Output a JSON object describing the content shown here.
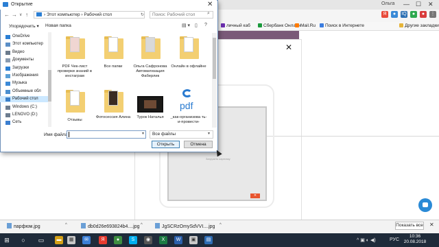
{
  "browser": {
    "user": "Ольга",
    "bookmarks": [
      {
        "label": "личный каб",
        "color": "#6c2fb0"
      },
      {
        "label": "Сбербанк Онлайн",
        "color": "#1a9a3c"
      },
      {
        "label": "Mail.Ru",
        "color": "#ff7a00"
      },
      {
        "label": "Поиск в Интернете",
        "color": "#3b7de0"
      },
      {
        "label": "Другие закладки",
        "color": "#e6b53a"
      }
    ]
  },
  "page": {
    "close_glyph": "✕",
    "screen_label": "Загрузить картинку",
    "screen_button": "✕"
  },
  "dialog": {
    "title": "Открытие",
    "path": [
      "Этот компьютер",
      "Рабочий стол"
    ],
    "search_placeholder": "Поиск: Рабочий стол",
    "toolbar": {
      "organize": "Упорядочить ▾",
      "new_folder": "Новая папка"
    },
    "nav_items": [
      {
        "label": "OneDrive",
        "icon": "onedrive-icon",
        "color": "#2b7fd4"
      },
      {
        "label": "Этот компьютер",
        "icon": "computer-icon",
        "color": "#5b8fc7"
      },
      {
        "label": "Видео",
        "icon": "video-icon",
        "color": "#6b7b8c"
      },
      {
        "label": "Документы",
        "icon": "documents-icon",
        "color": "#8a9bb0"
      },
      {
        "label": "Загрузки",
        "icon": "downloads-icon",
        "color": "#2b7fd4"
      },
      {
        "label": "Изображения",
        "icon": "pictures-icon",
        "color": "#5aa0d8"
      },
      {
        "label": "Музыка",
        "icon": "music-icon",
        "color": "#3b8ad8"
      },
      {
        "label": "Объемные обл",
        "icon": "3d-objects-icon",
        "color": "#4a8fd0"
      },
      {
        "label": "Рабочий стол",
        "icon": "desktop-icon",
        "color": "#3a7fc9"
      },
      {
        "label": "Windows (C:)",
        "icon": "drive-c-icon",
        "color": "#6d7d8f"
      },
      {
        "label": "LENOVO (D:)",
        "icon": "drive-d-icon",
        "color": "#6d7d8f"
      },
      {
        "label": "Сеть",
        "icon": "network-icon",
        "color": "#3b7fd0"
      }
    ],
    "files": [
      {
        "label": "PDF Чек-лист проверки знаний в инстаграм",
        "type": "folder"
      },
      {
        "label": "Все папки",
        "type": "folder"
      },
      {
        "label": "Ольга Сафронова Автоматизация Фаберлик",
        "type": "folder"
      },
      {
        "label": "Онлайн в офлайне",
        "type": "folder"
      },
      {
        "label": "Отзывы",
        "type": "folder"
      },
      {
        "label": "Фотосессия Алина",
        "type": "folder"
      },
      {
        "label": "Турок Наталья",
        "type": "video"
      },
      {
        "label": "_как-организова ть-и-провести-",
        "type": "pdf"
      }
    ],
    "filename_label": "Имя файла:",
    "filename_value": "",
    "filter": "Все файлы",
    "open_button": "Открыть",
    "cancel_button": "Отмена"
  },
  "downloads": {
    "items": [
      "парфюм.jpg",
      "db0d26e693824b4....jpg",
      "JgSCRzOmySdVVI....jpg"
    ],
    "show_all": "Показать все",
    "close_glyph": "✕"
  },
  "taskbar": {
    "lang": "РУС",
    "time": "10:36",
    "date": "20.08.2018"
  }
}
